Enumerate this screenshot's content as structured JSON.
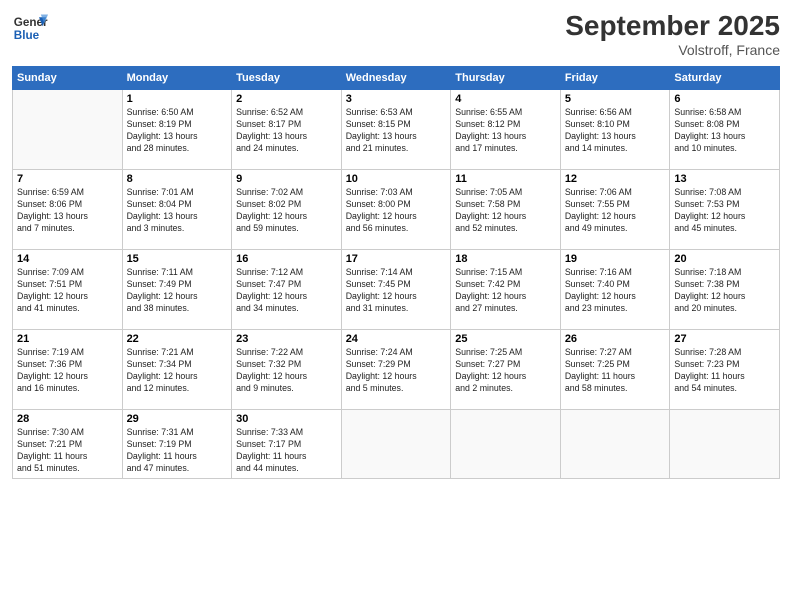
{
  "logo": {
    "general": "General",
    "blue": "Blue"
  },
  "title": "September 2025",
  "subtitle": "Volstroff, France",
  "headers": [
    "Sunday",
    "Monday",
    "Tuesday",
    "Wednesday",
    "Thursday",
    "Friday",
    "Saturday"
  ],
  "weeks": [
    [
      {
        "day": "",
        "info": ""
      },
      {
        "day": "1",
        "info": "Sunrise: 6:50 AM\nSunset: 8:19 PM\nDaylight: 13 hours\nand 28 minutes."
      },
      {
        "day": "2",
        "info": "Sunrise: 6:52 AM\nSunset: 8:17 PM\nDaylight: 13 hours\nand 24 minutes."
      },
      {
        "day": "3",
        "info": "Sunrise: 6:53 AM\nSunset: 8:15 PM\nDaylight: 13 hours\nand 21 minutes."
      },
      {
        "day": "4",
        "info": "Sunrise: 6:55 AM\nSunset: 8:12 PM\nDaylight: 13 hours\nand 17 minutes."
      },
      {
        "day": "5",
        "info": "Sunrise: 6:56 AM\nSunset: 8:10 PM\nDaylight: 13 hours\nand 14 minutes."
      },
      {
        "day": "6",
        "info": "Sunrise: 6:58 AM\nSunset: 8:08 PM\nDaylight: 13 hours\nand 10 minutes."
      }
    ],
    [
      {
        "day": "7",
        "info": "Sunrise: 6:59 AM\nSunset: 8:06 PM\nDaylight: 13 hours\nand 7 minutes."
      },
      {
        "day": "8",
        "info": "Sunrise: 7:01 AM\nSunset: 8:04 PM\nDaylight: 13 hours\nand 3 minutes."
      },
      {
        "day": "9",
        "info": "Sunrise: 7:02 AM\nSunset: 8:02 PM\nDaylight: 12 hours\nand 59 minutes."
      },
      {
        "day": "10",
        "info": "Sunrise: 7:03 AM\nSunset: 8:00 PM\nDaylight: 12 hours\nand 56 minutes."
      },
      {
        "day": "11",
        "info": "Sunrise: 7:05 AM\nSunset: 7:58 PM\nDaylight: 12 hours\nand 52 minutes."
      },
      {
        "day": "12",
        "info": "Sunrise: 7:06 AM\nSunset: 7:55 PM\nDaylight: 12 hours\nand 49 minutes."
      },
      {
        "day": "13",
        "info": "Sunrise: 7:08 AM\nSunset: 7:53 PM\nDaylight: 12 hours\nand 45 minutes."
      }
    ],
    [
      {
        "day": "14",
        "info": "Sunrise: 7:09 AM\nSunset: 7:51 PM\nDaylight: 12 hours\nand 41 minutes."
      },
      {
        "day": "15",
        "info": "Sunrise: 7:11 AM\nSunset: 7:49 PM\nDaylight: 12 hours\nand 38 minutes."
      },
      {
        "day": "16",
        "info": "Sunrise: 7:12 AM\nSunset: 7:47 PM\nDaylight: 12 hours\nand 34 minutes."
      },
      {
        "day": "17",
        "info": "Sunrise: 7:14 AM\nSunset: 7:45 PM\nDaylight: 12 hours\nand 31 minutes."
      },
      {
        "day": "18",
        "info": "Sunrise: 7:15 AM\nSunset: 7:42 PM\nDaylight: 12 hours\nand 27 minutes."
      },
      {
        "day": "19",
        "info": "Sunrise: 7:16 AM\nSunset: 7:40 PM\nDaylight: 12 hours\nand 23 minutes."
      },
      {
        "day": "20",
        "info": "Sunrise: 7:18 AM\nSunset: 7:38 PM\nDaylight: 12 hours\nand 20 minutes."
      }
    ],
    [
      {
        "day": "21",
        "info": "Sunrise: 7:19 AM\nSunset: 7:36 PM\nDaylight: 12 hours\nand 16 minutes."
      },
      {
        "day": "22",
        "info": "Sunrise: 7:21 AM\nSunset: 7:34 PM\nDaylight: 12 hours\nand 12 minutes."
      },
      {
        "day": "23",
        "info": "Sunrise: 7:22 AM\nSunset: 7:32 PM\nDaylight: 12 hours\nand 9 minutes."
      },
      {
        "day": "24",
        "info": "Sunrise: 7:24 AM\nSunset: 7:29 PM\nDaylight: 12 hours\nand 5 minutes."
      },
      {
        "day": "25",
        "info": "Sunrise: 7:25 AM\nSunset: 7:27 PM\nDaylight: 12 hours\nand 2 minutes."
      },
      {
        "day": "26",
        "info": "Sunrise: 7:27 AM\nSunset: 7:25 PM\nDaylight: 11 hours\nand 58 minutes."
      },
      {
        "day": "27",
        "info": "Sunrise: 7:28 AM\nSunset: 7:23 PM\nDaylight: 11 hours\nand 54 minutes."
      }
    ],
    [
      {
        "day": "28",
        "info": "Sunrise: 7:30 AM\nSunset: 7:21 PM\nDaylight: 11 hours\nand 51 minutes."
      },
      {
        "day": "29",
        "info": "Sunrise: 7:31 AM\nSunset: 7:19 PM\nDaylight: 11 hours\nand 47 minutes."
      },
      {
        "day": "30",
        "info": "Sunrise: 7:33 AM\nSunset: 7:17 PM\nDaylight: 11 hours\nand 44 minutes."
      },
      {
        "day": "",
        "info": ""
      },
      {
        "day": "",
        "info": ""
      },
      {
        "day": "",
        "info": ""
      },
      {
        "day": "",
        "info": ""
      }
    ]
  ]
}
